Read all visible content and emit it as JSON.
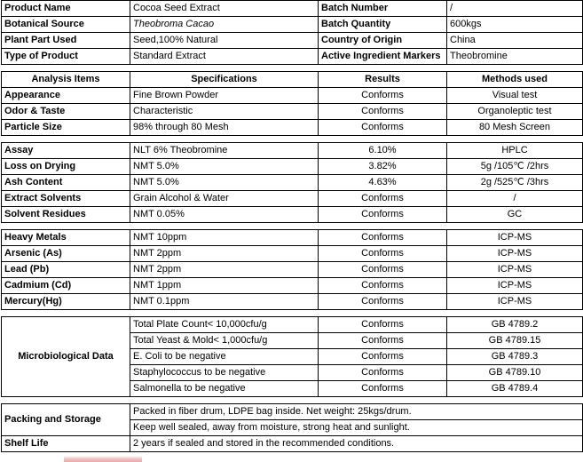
{
  "header_table": {
    "rows": [
      {
        "label": "Product Name",
        "value": "Cocoa Seed Extract",
        "label2": "Batch Number",
        "value2": "/"
      },
      {
        "label": "Botanical Source",
        "value": "Theobroma Cacao",
        "label2": "Batch Quantity",
        "value2": "600kgs"
      },
      {
        "label": "Plant Part Used",
        "value": "Seed,100% Natural",
        "label2": "Country of Origin",
        "value2": "China"
      },
      {
        "label": "Type of Product",
        "value": "Standard Extract",
        "label2": "Active Ingredient Markers",
        "value2": "Theobromine"
      }
    ]
  },
  "analysis_table": {
    "columns": [
      "Analysis Items",
      "Specifications",
      "Results",
      "Methods used"
    ],
    "organoleptic": [
      {
        "item": "Appearance",
        "spec": "Fine Brown Powder",
        "result": "Conforms",
        "method": "Visual test"
      },
      {
        "item": "Odor & Taste",
        "spec": "Characteristic",
        "result": "Conforms",
        "method": "Organoleptic test"
      },
      {
        "item": "Particle Size",
        "spec": "98% through 80 Mesh",
        "result": "Conforms",
        "method": "80 Mesh Screen"
      }
    ],
    "physical": [
      {
        "item": "Assay",
        "spec": "NLT 6% Theobromine",
        "result": "6.10%",
        "method": "HPLC"
      },
      {
        "item": "Loss on Drying",
        "spec": "NMT 5.0%",
        "result": "3.82%",
        "method": "5g /105℃ /2hrs"
      },
      {
        "item": "Ash Content",
        "spec": "NMT 5.0%",
        "result": "4.63%",
        "method": "2g /525℃ /3hrs"
      },
      {
        "item": "Extract Solvents",
        "spec": "Grain Alcohol & Water",
        "result": "Conforms",
        "method": "/"
      },
      {
        "item": "Solvent Residues",
        "spec": "NMT 0.05%",
        "result": "Conforms",
        "method": "GC"
      }
    ],
    "heavy_metals": [
      {
        "item": "Heavy Metals",
        "spec": "NMT 10ppm",
        "result": "Conforms",
        "method": "ICP-MS"
      },
      {
        "item": "Arsenic (As)",
        "spec": "NMT 2ppm",
        "result": "Conforms",
        "method": "ICP-MS"
      },
      {
        "item": "Lead (Pb)",
        "spec": "NMT 2ppm",
        "result": "Conforms",
        "method": "ICP-MS"
      },
      {
        "item": "Cadmium (Cd)",
        "spec": "NMT 1ppm",
        "result": "Conforms",
        "method": "ICP-MS"
      },
      {
        "item": "Mercury(Hg)",
        "spec": "NMT 0.1ppm",
        "result": "Conforms",
        "method": "ICP-MS"
      }
    ],
    "microbiological": {
      "group_label": "Microbiological Data",
      "rows": [
        {
          "spec": "Total Plate Count< 10,000cfu/g",
          "result": "Conforms",
          "method": "GB 4789.2"
        },
        {
          "spec": "Total Yeast & Mold< 1,000cfu/g",
          "result": "Conforms",
          "method": "GB 4789.15"
        },
        {
          "spec": "E. Coli to be negative",
          "result": "Conforms",
          "method": "GB 4789.3"
        },
        {
          "spec": "Staphylococcus to be negative",
          "result": "Conforms",
          "method": "GB 4789.10"
        },
        {
          "spec": "Salmonella to be negative",
          "result": "Conforms",
          "method": "GB 4789.4"
        }
      ]
    },
    "footer": {
      "packing_label": "Packing and Storage",
      "packing_line1": "Packed in fiber drum, LDPE bag inside. Net weight: 25kgs/drum.",
      "packing_line2": "Keep well sealed, away from moisture, strong heat and sunlight.",
      "shelf_label": "Shelf Life",
      "shelf_value": "2 years if sealed and stored in the recommended conditions."
    }
  },
  "colors": {
    "border": "#000000",
    "text": "#000000",
    "stamp": "#d6685f"
  }
}
